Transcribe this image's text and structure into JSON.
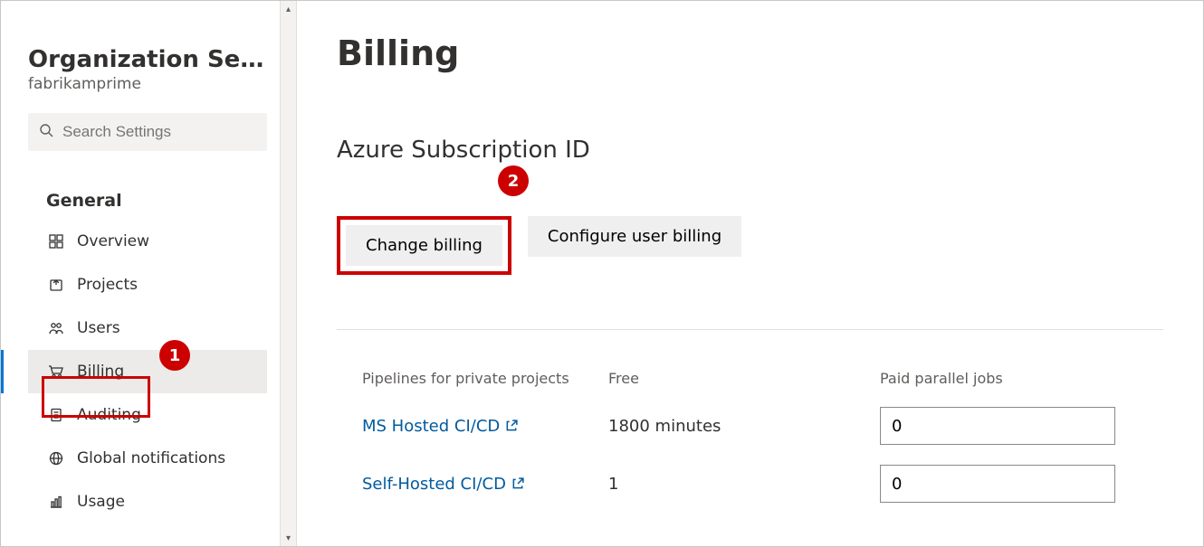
{
  "sidebar": {
    "title": "Organization Settin…",
    "subtitle": "fabrikamprime",
    "search_placeholder": "Search Settings",
    "section_label": "General",
    "items": [
      {
        "label": "Overview"
      },
      {
        "label": "Projects"
      },
      {
        "label": "Users"
      },
      {
        "label": "Billing"
      },
      {
        "label": "Auditing"
      },
      {
        "label": "Global notifications"
      },
      {
        "label": "Usage"
      }
    ]
  },
  "callouts": {
    "one": "1",
    "two": "2"
  },
  "main": {
    "title": "Billing",
    "subheading": "Azure Subscription ID",
    "buttons": {
      "change": "Change billing",
      "configure": "Configure user billing"
    },
    "table": {
      "headers": {
        "a": "Pipelines for private projects",
        "b": "Free",
        "c": "Paid parallel jobs"
      },
      "rows": [
        {
          "name": "MS Hosted CI/CD",
          "free": "1800 minutes",
          "paid": "0"
        },
        {
          "name": "Self-Hosted CI/CD",
          "free": "1",
          "paid": "0"
        }
      ]
    }
  }
}
